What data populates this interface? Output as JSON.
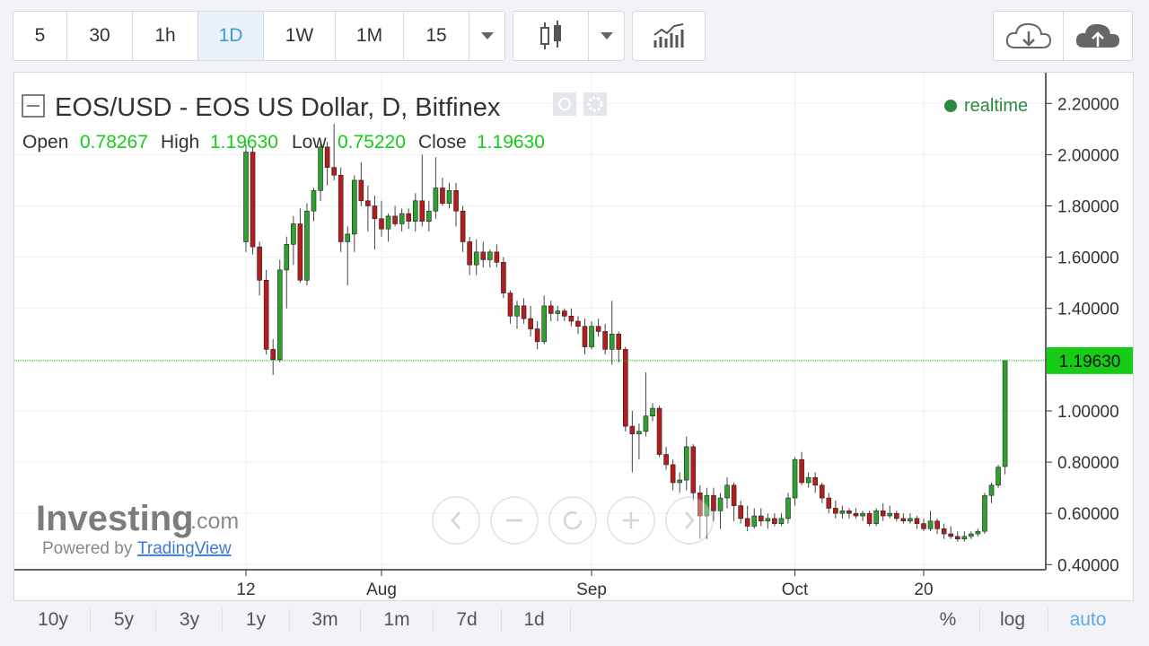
{
  "toolbar": {
    "intervals": [
      "5",
      "30",
      "1h",
      "1D",
      "1W",
      "1M",
      "15"
    ],
    "active_interval": "1D"
  },
  "legend": {
    "title": "EOS/USD - EOS US Dollar, D, Bitfinex",
    "realtime": "realtime",
    "open_label": "Open",
    "open_value": "0.78267",
    "high_label": "High",
    "high_value": "1.19630",
    "low_label": "Low",
    "low_value": "0.75220",
    "close_label": "Close",
    "close_value": "1.19630"
  },
  "branding": {
    "brand": "Investing",
    "brand_suffix": ".com",
    "powered": "Powered by",
    "powered_link": "TradingView"
  },
  "ranges": [
    "10y",
    "5y",
    "3y",
    "1y",
    "3m",
    "1m",
    "7d",
    "1d"
  ],
  "scale": {
    "percent": "%",
    "log": "log",
    "auto": "auto"
  },
  "colors": {
    "up": "#2fa12f",
    "down": "#b71c1c",
    "last_price_bg": "#16cc16",
    "accent": "#3c9bd9",
    "realtime_dot": "#2b8a3e"
  },
  "chart_data": {
    "type": "candlestick",
    "symbol": "EOS/USD",
    "exchange": "Bitfinex",
    "interval": "D",
    "x_labels": [
      {
        "i": 0,
        "label": "12"
      },
      {
        "i": 20,
        "label": "Aug"
      },
      {
        "i": 51,
        "label": "Sep"
      },
      {
        "i": 81,
        "label": "Oct"
      },
      {
        "i": 100,
        "label": "20"
      }
    ],
    "y_ticks": [
      "0.40000",
      "0.60000",
      "0.80000",
      "1.00000",
      "1.20000",
      "1.40000",
      "1.60000",
      "1.80000",
      "2.00000",
      "2.20000"
    ],
    "y_tick_values": [
      0.4,
      0.6,
      0.8,
      1.0,
      1.2,
      1.4,
      1.6,
      1.8,
      2.0,
      2.2
    ],
    "ylim": [
      0.38,
      2.32
    ],
    "last_price": 1.1963,
    "last_price_label": "1.19630",
    "candles": [
      [
        1.66,
        2.04,
        1.62,
        2.01
      ],
      [
        2.01,
        2.03,
        1.61,
        1.64
      ],
      [
        1.64,
        1.66,
        1.45,
        1.51
      ],
      [
        1.51,
        1.55,
        1.22,
        1.24
      ],
      [
        1.24,
        1.28,
        1.14,
        1.2
      ],
      [
        1.2,
        1.59,
        1.19,
        1.55
      ],
      [
        1.55,
        1.68,
        1.4,
        1.65
      ],
      [
        1.65,
        1.76,
        1.57,
        1.73
      ],
      [
        1.73,
        1.79,
        1.5,
        1.51
      ],
      [
        1.51,
        1.81,
        1.49,
        1.78
      ],
      [
        1.78,
        1.87,
        1.74,
        1.86
      ],
      [
        1.86,
        2.05,
        1.82,
        2.03
      ],
      [
        2.03,
        2.05,
        1.88,
        1.95
      ],
      [
        1.95,
        2.12,
        1.9,
        1.92
      ],
      [
        1.92,
        1.95,
        1.62,
        1.66
      ],
      [
        1.66,
        1.72,
        1.49,
        1.69
      ],
      [
        1.69,
        1.92,
        1.62,
        1.9
      ],
      [
        1.9,
        1.97,
        1.8,
        1.82
      ],
      [
        1.82,
        1.88,
        1.7,
        1.8
      ],
      [
        1.8,
        1.84,
        1.63,
        1.75
      ],
      [
        1.75,
        1.82,
        1.68,
        1.71
      ],
      [
        1.71,
        1.77,
        1.66,
        1.76
      ],
      [
        1.76,
        1.8,
        1.72,
        1.73
      ],
      [
        1.73,
        1.79,
        1.7,
        1.77
      ],
      [
        1.77,
        1.79,
        1.71,
        1.74
      ],
      [
        1.74,
        1.85,
        1.7,
        1.82
      ],
      [
        1.82,
        2.0,
        1.72,
        1.74
      ],
      [
        1.74,
        1.82,
        1.7,
        1.78
      ],
      [
        1.78,
        1.99,
        1.75,
        1.87
      ],
      [
        1.87,
        1.91,
        1.8,
        1.81
      ],
      [
        1.81,
        1.89,
        1.79,
        1.86
      ],
      [
        1.86,
        1.89,
        1.72,
        1.78
      ],
      [
        1.78,
        1.8,
        1.62,
        1.66
      ],
      [
        1.66,
        1.68,
        1.53,
        1.57
      ],
      [
        1.57,
        1.67,
        1.53,
        1.62
      ],
      [
        1.62,
        1.66,
        1.56,
        1.59
      ],
      [
        1.59,
        1.63,
        1.56,
        1.62
      ],
      [
        1.62,
        1.65,
        1.56,
        1.58
      ],
      [
        1.58,
        1.6,
        1.44,
        1.46
      ],
      [
        1.46,
        1.47,
        1.34,
        1.37
      ],
      [
        1.37,
        1.43,
        1.32,
        1.41
      ],
      [
        1.41,
        1.44,
        1.34,
        1.36
      ],
      [
        1.36,
        1.41,
        1.29,
        1.32
      ],
      [
        1.32,
        1.35,
        1.24,
        1.27
      ],
      [
        1.27,
        1.45,
        1.26,
        1.41
      ],
      [
        1.41,
        1.43,
        1.35,
        1.38
      ],
      [
        1.38,
        1.41,
        1.35,
        1.39
      ],
      [
        1.39,
        1.4,
        1.35,
        1.37
      ],
      [
        1.37,
        1.4,
        1.33,
        1.35
      ],
      [
        1.35,
        1.37,
        1.3,
        1.33
      ],
      [
        1.33,
        1.36,
        1.22,
        1.25
      ],
      [
        1.25,
        1.35,
        1.24,
        1.33
      ],
      [
        1.33,
        1.36,
        1.29,
        1.31
      ],
      [
        1.31,
        1.34,
        1.22,
        1.24
      ],
      [
        1.24,
        1.43,
        1.18,
        1.3
      ],
      [
        1.3,
        1.31,
        1.19,
        1.24
      ],
      [
        1.24,
        1.25,
        0.92,
        0.94
      ],
      [
        0.94,
        1.0,
        0.76,
        0.91
      ],
      [
        0.91,
        0.95,
        0.81,
        0.92
      ],
      [
        0.92,
        1.15,
        0.9,
        0.98
      ],
      [
        0.98,
        1.03,
        0.96,
        1.01
      ],
      [
        1.01,
        1.02,
        0.82,
        0.83
      ],
      [
        0.83,
        0.86,
        0.77,
        0.79
      ],
      [
        0.79,
        0.81,
        0.69,
        0.72
      ],
      [
        0.72,
        0.76,
        0.68,
        0.73
      ],
      [
        0.73,
        0.9,
        0.69,
        0.86
      ],
      [
        0.86,
        0.87,
        0.65,
        0.68
      ],
      [
        0.68,
        0.71,
        0.5,
        0.59
      ],
      [
        0.59,
        0.7,
        0.5,
        0.67
      ],
      [
        0.67,
        0.7,
        0.57,
        0.61
      ],
      [
        0.61,
        0.68,
        0.54,
        0.66
      ],
      [
        0.66,
        0.74,
        0.62,
        0.71
      ],
      [
        0.71,
        0.72,
        0.57,
        0.63
      ],
      [
        0.63,
        0.65,
        0.56,
        0.58
      ],
      [
        0.58,
        0.63,
        0.53,
        0.55
      ],
      [
        0.55,
        0.62,
        0.54,
        0.59
      ],
      [
        0.59,
        0.62,
        0.55,
        0.57
      ],
      [
        0.57,
        0.6,
        0.54,
        0.58
      ],
      [
        0.58,
        0.6,
        0.55,
        0.56
      ],
      [
        0.56,
        0.6,
        0.55,
        0.58
      ],
      [
        0.58,
        0.68,
        0.56,
        0.66
      ],
      [
        0.66,
        0.82,
        0.63,
        0.81
      ],
      [
        0.81,
        0.84,
        0.71,
        0.72
      ],
      [
        0.72,
        0.76,
        0.7,
        0.74
      ],
      [
        0.74,
        0.76,
        0.68,
        0.71
      ],
      [
        0.71,
        0.72,
        0.64,
        0.66
      ],
      [
        0.66,
        0.68,
        0.6,
        0.62
      ],
      [
        0.62,
        0.65,
        0.58,
        0.6
      ],
      [
        0.6,
        0.63,
        0.58,
        0.61
      ],
      [
        0.61,
        0.62,
        0.58,
        0.6
      ],
      [
        0.6,
        0.62,
        0.58,
        0.59
      ],
      [
        0.59,
        0.61,
        0.57,
        0.6
      ],
      [
        0.6,
        0.61,
        0.55,
        0.56
      ],
      [
        0.56,
        0.62,
        0.55,
        0.61
      ],
      [
        0.61,
        0.64,
        0.57,
        0.59
      ],
      [
        0.59,
        0.63,
        0.58,
        0.6
      ],
      [
        0.6,
        0.61,
        0.57,
        0.58
      ],
      [
        0.58,
        0.6,
        0.56,
        0.57
      ],
      [
        0.57,
        0.6,
        0.56,
        0.58
      ],
      [
        0.58,
        0.59,
        0.54,
        0.56
      ],
      [
        0.56,
        0.58,
        0.53,
        0.54
      ],
      [
        0.54,
        0.61,
        0.53,
        0.57
      ],
      [
        0.57,
        0.58,
        0.52,
        0.54
      ],
      [
        0.54,
        0.56,
        0.5,
        0.52
      ],
      [
        0.52,
        0.55,
        0.5,
        0.51
      ],
      [
        0.51,
        0.53,
        0.49,
        0.5
      ],
      [
        0.5,
        0.53,
        0.49,
        0.51
      ],
      [
        0.51,
        0.53,
        0.5,
        0.52
      ],
      [
        0.52,
        0.54,
        0.51,
        0.53
      ],
      [
        0.53,
        0.68,
        0.52,
        0.67
      ],
      [
        0.67,
        0.72,
        0.64,
        0.71
      ],
      [
        0.71,
        0.79,
        0.7,
        0.78
      ],
      [
        0.78267,
        1.1963,
        0.7522,
        1.1963
      ]
    ]
  }
}
